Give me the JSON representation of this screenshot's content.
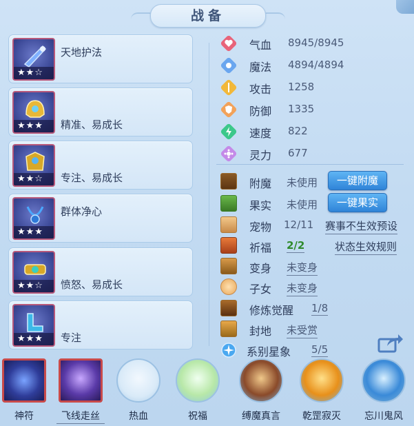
{
  "title": "战备",
  "equipment": [
    {
      "name": "天地护法",
      "stars": "★★☆",
      "color": "#5b6fd8"
    },
    {
      "name": "精准、易成长",
      "stars": "★★★",
      "color": "#e0b030"
    },
    {
      "name": "专注、易成长",
      "stars": "★★☆",
      "color": "#d8a828"
    },
    {
      "name": "群体净心",
      "stars": "★★★",
      "color": "#3c8fd8"
    },
    {
      "name": "愤怒、易成长",
      "stars": "★★☆",
      "color": "#d8a828"
    },
    {
      "name": "专注",
      "stars": "★★★",
      "color": "#3cb8e8"
    }
  ],
  "stats": [
    {
      "label": "气血",
      "value": "8945/8945",
      "icon": "heart-icon",
      "color": "#e8647a"
    },
    {
      "label": "魔法",
      "value": "4894/4894",
      "icon": "mana-icon",
      "color": "#6aa6ef"
    },
    {
      "label": "攻击",
      "value": "1258",
      "icon": "attack-icon",
      "color": "#f2b83a"
    },
    {
      "label": "防御",
      "value": "1335",
      "icon": "defense-icon",
      "color": "#f2a25a"
    },
    {
      "label": "速度",
      "value": "822",
      "icon": "speed-icon",
      "color": "#3cc88a"
    },
    {
      "label": "灵力",
      "value": "677",
      "icon": "spirit-icon",
      "color": "#c48ae8"
    }
  ],
  "features": {
    "enchant": {
      "label": "附魔",
      "value": "未使用",
      "button": "一键附魔"
    },
    "fruit": {
      "label": "果实",
      "value": "未使用",
      "button": "一键果实"
    },
    "pet": {
      "label": "宠物",
      "value": "12/11",
      "link": "赛事不生效预设"
    },
    "bless": {
      "label": "祈福",
      "value": "2/2",
      "link": "状态生效规则"
    },
    "transform": {
      "label": "变身",
      "value": "未变身"
    },
    "child": {
      "label": "子女",
      "value": "未变身"
    },
    "cultivate": {
      "label": "修炼觉醒",
      "value": "1/8"
    },
    "fief": {
      "label": "封地",
      "value": "未受赏"
    },
    "constellation": {
      "label": "系别星象",
      "value": "5/5"
    }
  },
  "skills": [
    {
      "label": "神符"
    },
    {
      "label": "飞线走丝"
    },
    {
      "label": "热血"
    },
    {
      "label": "祝福"
    },
    {
      "label": "缚魔真言"
    },
    {
      "label": "乾罡寂灭"
    },
    {
      "label": "忘川鬼风"
    }
  ]
}
